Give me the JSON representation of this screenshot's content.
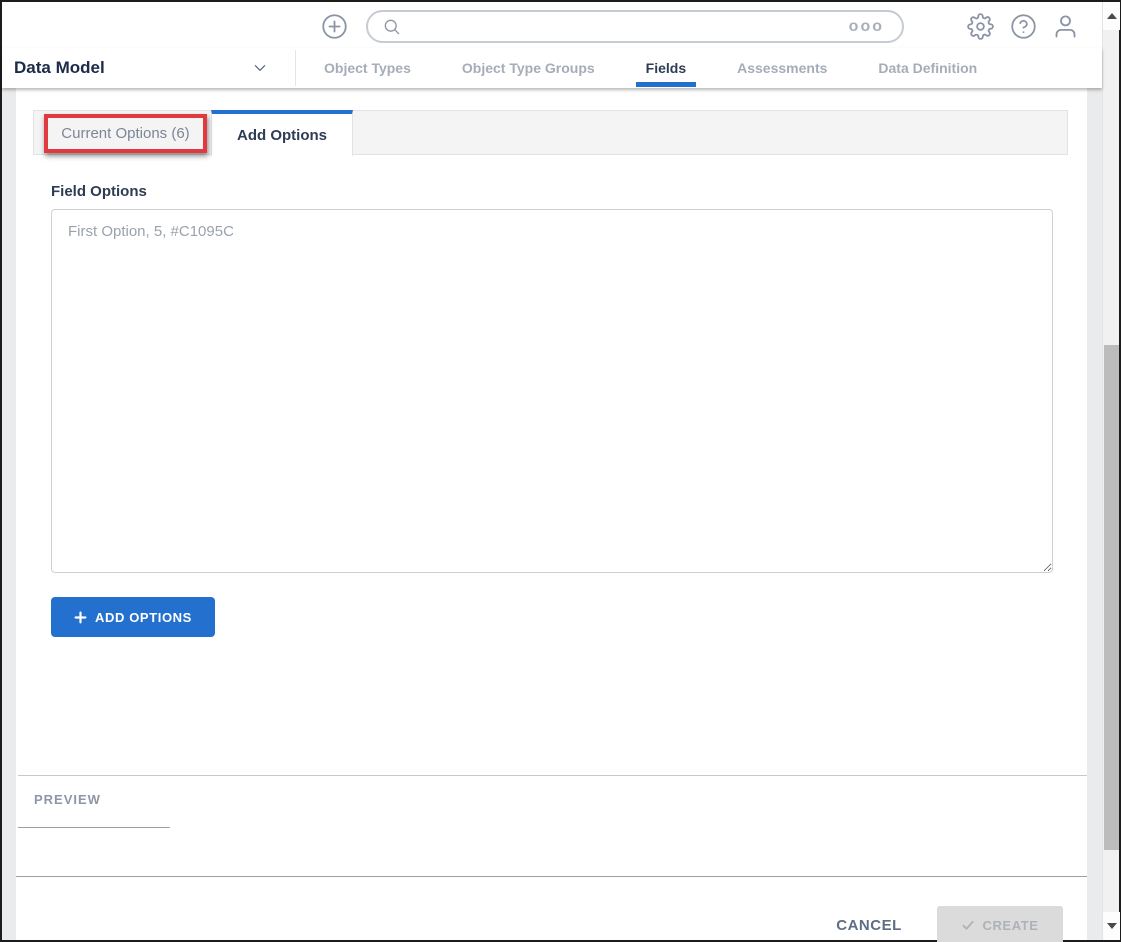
{
  "header": {
    "search_placeholder": "",
    "more_indicator": "ooo"
  },
  "nav": {
    "module_label": "Data Model",
    "items": [
      {
        "label": "Object Types",
        "active": false
      },
      {
        "label": "Object Type Groups",
        "active": false
      },
      {
        "label": "Fields",
        "active": true
      },
      {
        "label": "Assessments",
        "active": false
      },
      {
        "label": "Data Definition",
        "active": false
      }
    ]
  },
  "tabs": {
    "current": {
      "label": "Current Options (6)",
      "active": false,
      "annotated": true
    },
    "add": {
      "label": "Add Options",
      "active": true
    }
  },
  "form": {
    "field_options_label": "Field Options",
    "options_placeholder": "First Option, 5, #C1095C",
    "options_value": "",
    "add_options_label": "ADD OPTIONS"
  },
  "preview": {
    "label": "PREVIEW"
  },
  "footer": {
    "cancel_label": "CANCEL",
    "create_label": "CREATE",
    "create_enabled": false
  },
  "colors": {
    "accent_blue": "#2470CE",
    "annotation_red": "#E0393E",
    "inactive_gray": "#A6ADB9"
  }
}
